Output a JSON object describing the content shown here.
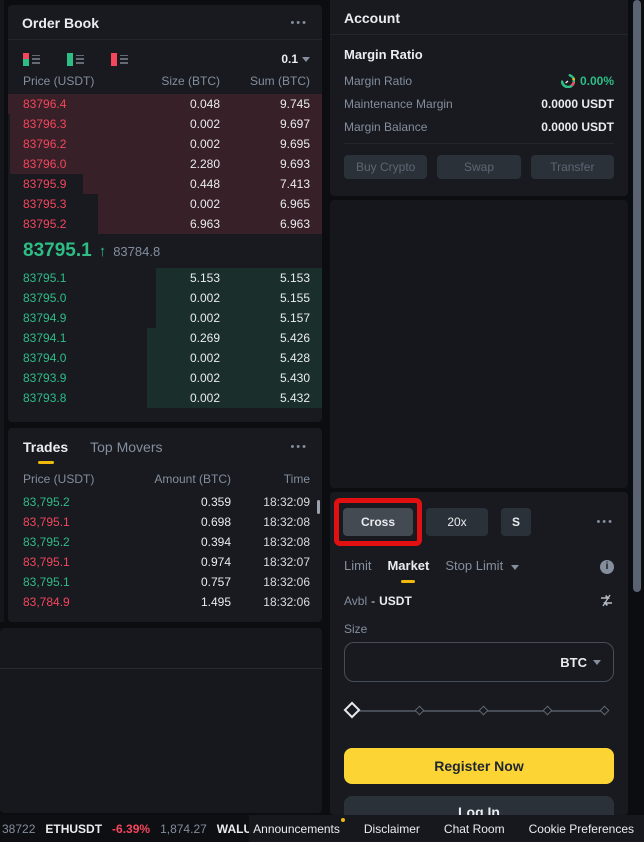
{
  "icons": {
    "more": "•••",
    "arrow_up": "↑",
    "info": "i"
  },
  "order_book": {
    "title": "Order Book",
    "precision": "0.1",
    "columns": {
      "price": "Price (USDT)",
      "size": "Size (BTC)",
      "sum": "Sum (BTC)"
    },
    "asks": [
      {
        "price": "83796.4",
        "size": "0.048",
        "sum": "9.745"
      },
      {
        "price": "83796.3",
        "size": "0.002",
        "sum": "9.697"
      },
      {
        "price": "83796.2",
        "size": "0.002",
        "sum": "9.695"
      },
      {
        "price": "83796.0",
        "size": "2.280",
        "sum": "9.693"
      },
      {
        "price": "83795.9",
        "size": "0.448",
        "sum": "7.413"
      },
      {
        "price": "83795.3",
        "size": "0.002",
        "sum": "6.965"
      },
      {
        "price": "83795.2",
        "size": "6.963",
        "sum": "6.963"
      }
    ],
    "mid": {
      "price": "83795.1",
      "direction": "up",
      "mark_price": "83784.8"
    },
    "bids": [
      {
        "price": "83795.1",
        "size": "5.153",
        "sum": "5.153"
      },
      {
        "price": "83795.0",
        "size": "0.002",
        "sum": "5.155"
      },
      {
        "price": "83794.9",
        "size": "0.002",
        "sum": "5.157"
      },
      {
        "price": "83794.1",
        "size": "0.269",
        "sum": "5.426"
      },
      {
        "price": "83794.0",
        "size": "0.002",
        "sum": "5.428"
      },
      {
        "price": "83793.9",
        "size": "0.002",
        "sum": "5.430"
      },
      {
        "price": "83793.8",
        "size": "0.002",
        "sum": "5.432"
      }
    ]
  },
  "trades": {
    "tabs": {
      "trades": "Trades",
      "top_movers": "Top Movers"
    },
    "columns": {
      "price": "Price (USDT)",
      "amount": "Amount (BTC)",
      "time": "Time"
    },
    "rows": [
      {
        "price": "83,795.2",
        "side": "up",
        "amount": "0.359",
        "time": "18:32:09"
      },
      {
        "price": "83,795.1",
        "side": "down",
        "amount": "0.698",
        "time": "18:32:08"
      },
      {
        "price": "83,795.2",
        "side": "up",
        "amount": "0.394",
        "time": "18:32:08"
      },
      {
        "price": "83,795.1",
        "side": "down",
        "amount": "0.974",
        "time": "18:32:07"
      },
      {
        "price": "83,795.1",
        "side": "up",
        "amount": "0.757",
        "time": "18:32:06"
      },
      {
        "price": "83,784.9",
        "side": "down",
        "amount": "1.495",
        "time": "18:32:06"
      }
    ]
  },
  "account": {
    "title": "Account",
    "section_title": "Margin Ratio",
    "margin_ratio_label": "Margin Ratio",
    "margin_ratio_value": "0.00%",
    "maintenance_margin_label": "Maintenance Margin",
    "maintenance_margin_value": "0.0000 USDT",
    "margin_balance_label": "Margin Balance",
    "margin_balance_value": "0.0000 USDT",
    "buttons": {
      "buy_crypto": "Buy Crypto",
      "swap": "Swap",
      "transfer": "Transfer"
    }
  },
  "trade_form": {
    "margin_mode": "Cross",
    "leverage": "20x",
    "s_button": "S",
    "tabs": {
      "limit": "Limit",
      "market": "Market",
      "stop_limit": "Stop Limit"
    },
    "active_tab": "Market",
    "avbl_label": "Avbl",
    "avbl_separator": "-",
    "avbl_asset": "USDT",
    "size_label": "Size",
    "size_value": "",
    "size_unit": "BTC",
    "register_button": "Register Now",
    "login_button": "Log In"
  },
  "footer": {
    "ticker_prev_price": "38722",
    "ticker_symbol": "ETHUSDT",
    "ticker_change": "-6.39%",
    "ticker_price": "1,874.27",
    "ticker_next_symbol": "WALUS",
    "links": {
      "announcements": "Announcements",
      "disclaimer": "Disclaimer",
      "chat_room": "Chat Room",
      "cookie_preferences": "Cookie Preferences"
    }
  },
  "colors": {
    "panel_bg": "#181a20",
    "page_bg": "#0b0d10",
    "up_green": "#2ebd85",
    "down_red": "#f6465d",
    "accent_yellow": "#fcd535",
    "tab_underline": "#f0b90b",
    "annotation_red": "#e21010",
    "text_secondary": "#848e9c"
  }
}
